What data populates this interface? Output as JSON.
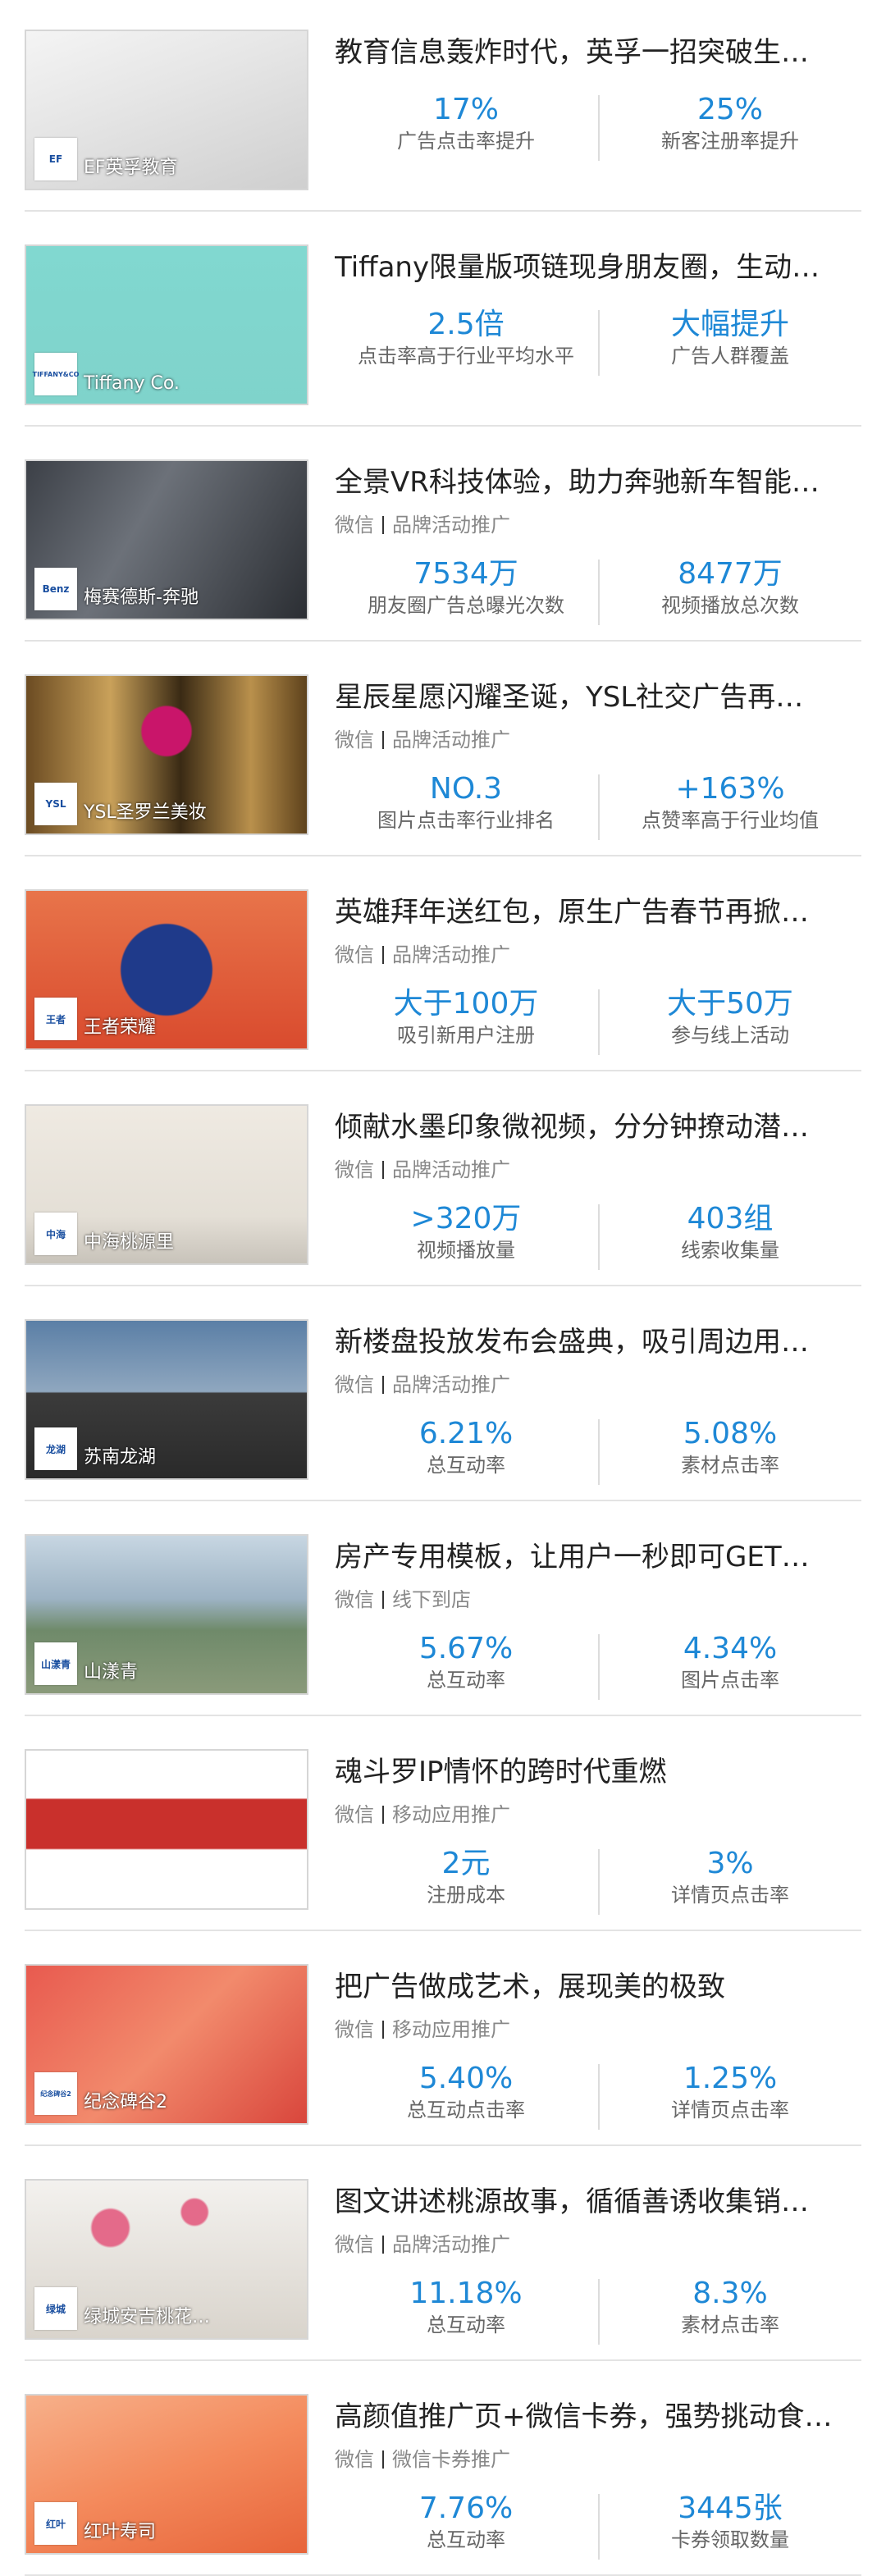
{
  "cases": [
    {
      "title": "教育信息轰炸时代，英孚一招突破生…",
      "brand": "EF英孚教育",
      "logo": "EF",
      "channel": "",
      "type": "",
      "stats": [
        {
          "value": "17%",
          "label": "广告点击率提升"
        },
        {
          "value": "25%",
          "label": "新客注册率提升"
        }
      ],
      "theme": "notebook-desk"
    },
    {
      "title": "Tiffany限量版项链现身朋友圈，生动…",
      "brand": "Tiffany Co.",
      "logo": "TIFFANY&CO",
      "channel": "",
      "type": "",
      "stats": [
        {
          "value": "2.5倍",
          "label": "点击率高于行业平均水平"
        },
        {
          "value": "大幅提升",
          "label": "广告人群覆盖"
        }
      ],
      "theme": "tiffany-necklace"
    },
    {
      "title": "全景VR科技体验，助力奔驰新车智能…",
      "brand": "梅赛德斯-奔驰",
      "logo": "Benz",
      "channel": "微信",
      "type": "品牌活动推广",
      "stats": [
        {
          "value": "7534万",
          "label": "朋友圈广告总曝光次数"
        },
        {
          "value": "8477万",
          "label": "视频播放总次数"
        }
      ],
      "theme": "vr-car"
    },
    {
      "title": "星辰星愿闪耀圣诞，YSL社交广告再…",
      "brand": "YSL圣罗兰美妆",
      "logo": "YSL",
      "channel": "微信",
      "type": "品牌活动推广",
      "stats": [
        {
          "value": "NO.3",
          "label": "图片点击率行业排名"
        },
        {
          "value": "+163%",
          "label": "点赞率高于行业均值"
        }
      ],
      "theme": "lipstick"
    },
    {
      "title": "英雄拜年送红包，原生广告春节再掀…",
      "brand": "王者荣耀",
      "logo": "王者",
      "channel": "微信",
      "type": "品牌活动推广",
      "stats": [
        {
          "value": "大于100万",
          "label": "吸引新用户注册"
        },
        {
          "value": "大于50万",
          "label": "参与线上活动"
        }
      ],
      "theme": "game-phone"
    },
    {
      "title": "倾献水墨印象微视频，分分钟撩动潜…",
      "brand": "中海桃源里",
      "logo": "中海",
      "channel": "微信",
      "type": "品牌活动推广",
      "stats": [
        {
          "value": ">320万",
          "label": "视频播放量"
        },
        {
          "value": "403组",
          "label": "线索收集量"
        }
      ],
      "theme": "ink-wash"
    },
    {
      "title": "新楼盘投放发布会盛典，吸引周边用…",
      "brand": "苏南龙湖",
      "logo": "龙湖",
      "channel": "微信",
      "type": "品牌活动推广",
      "stats": [
        {
          "value": "6.21%",
          "label": "总互动率"
        },
        {
          "value": "5.08%",
          "label": "素材点击率"
        }
      ],
      "theme": "building"
    },
    {
      "title": "房产专用模板，让用户一秒即可GET…",
      "brand": "山漾青",
      "logo": "山漾青",
      "channel": "微信",
      "type": "线下到店",
      "stats": [
        {
          "value": "5.67%",
          "label": "总互动率"
        },
        {
          "value": "4.34%",
          "label": "图片点击率"
        }
      ],
      "theme": "city-view"
    },
    {
      "title": "魂斗罗IP情怀的跨时代重燃",
      "brand": "",
      "logo": "",
      "channel": "微信",
      "type": "移动应用推广",
      "stats": [
        {
          "value": "2元",
          "label": "注册成本"
        },
        {
          "value": "3%",
          "label": "详情页点击率"
        }
      ],
      "theme": "contra"
    },
    {
      "title": "把广告做成艺术，展现美的极致",
      "brand": "纪念碑谷2",
      "logo": "纪念碑谷2",
      "channel": "微信",
      "type": "移动应用推广",
      "stats": [
        {
          "value": "5.40%",
          "label": "总互动点击率"
        },
        {
          "value": "1.25%",
          "label": "详情页点击率"
        }
      ],
      "theme": "monument"
    },
    {
      "title": "图文讲述桃源故事，循循善诱收集销…",
      "brand": "绿城安吉桃花…",
      "logo": "绿城",
      "channel": "微信",
      "type": "品牌活动推广",
      "stats": [
        {
          "value": "11.18%",
          "label": "总互动率"
        },
        {
          "value": "8.3%",
          "label": "素材点击率"
        }
      ],
      "theme": "blossom"
    },
    {
      "title": "高颜值推广页+微信卡券，强势挑动食…",
      "brand": "红叶寿司",
      "logo": "红叶",
      "channel": "微信",
      "type": "微信卡券推广",
      "stats": [
        {
          "value": "7.76%",
          "label": "总互动率"
        },
        {
          "value": "3445张",
          "label": "卡券领取数量"
        }
      ],
      "theme": "sushi"
    }
  ]
}
